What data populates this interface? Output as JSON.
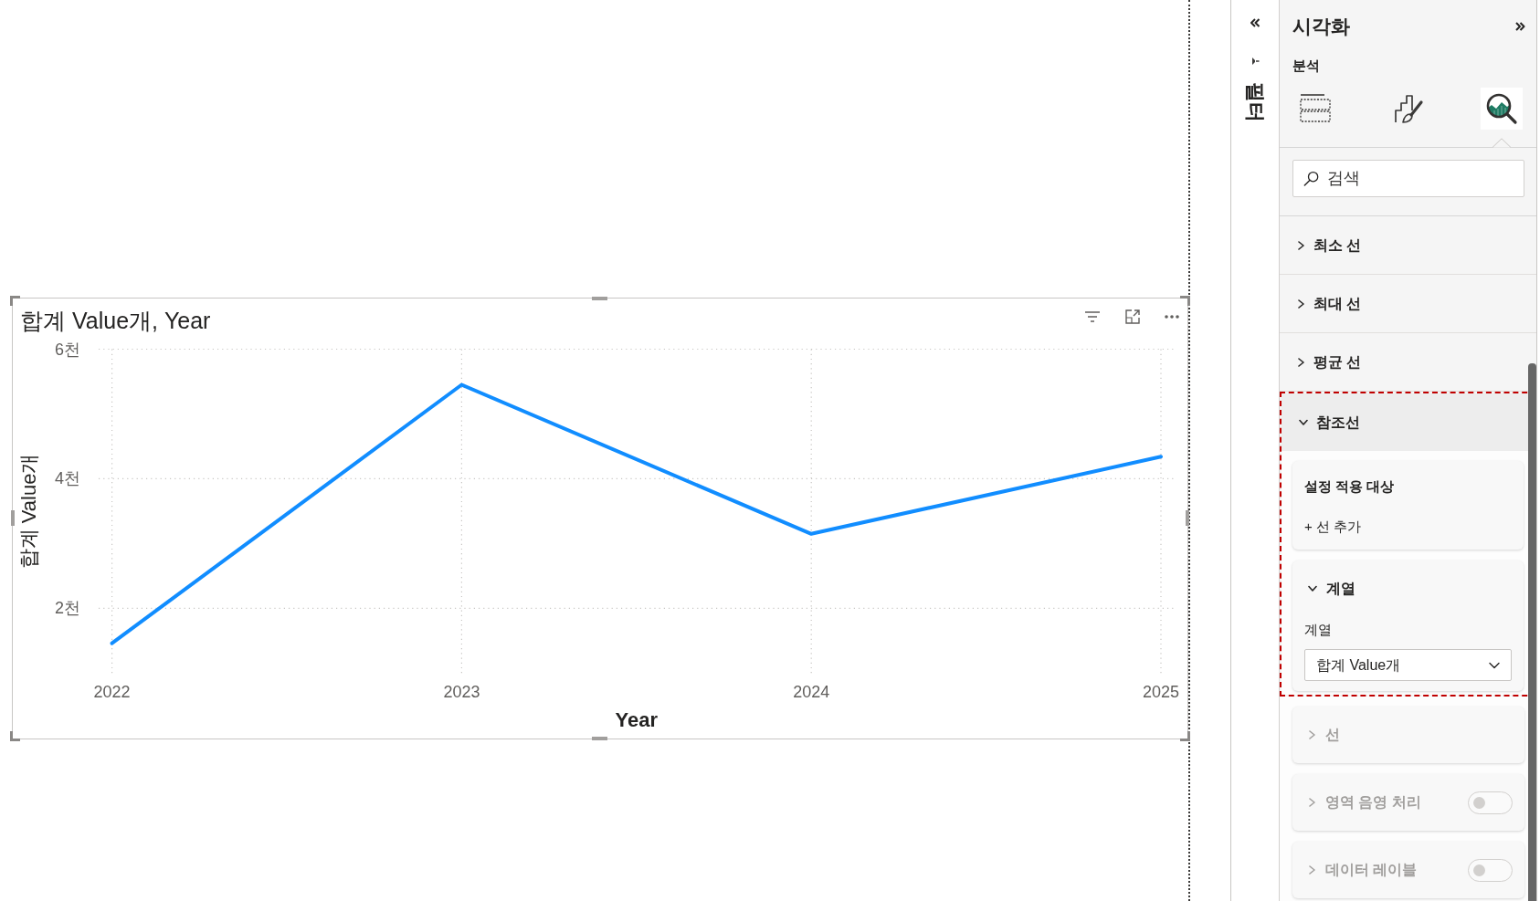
{
  "report_canvas": {
    "visual": {
      "selected": true,
      "chart_data": {
        "type": "line",
        "title": "합계 Value개, Year",
        "xlabel": "Year",
        "ylabel": "합계 Value개",
        "categories": [
          "2022",
          "2023",
          "2024",
          "2025"
        ],
        "series": [
          {
            "color": "#118dff",
            "values": [
              1.46,
              5.45,
              3.15,
              4.34
            ]
          }
        ],
        "ylim": [
          1,
          6
        ],
        "yticks": [
          {
            "value": 2,
            "label": "2천"
          },
          {
            "value": 4,
            "label": "4천"
          },
          {
            "value": 6,
            "label": "6천"
          }
        ],
        "grid": true
      }
    }
  },
  "filters_pane": {
    "title": "필터"
  },
  "visualizations_pane": {
    "title": "시각화",
    "subtitle": "분석",
    "tabs": [
      {
        "kind": "build",
        "selected": false
      },
      {
        "kind": "format",
        "selected": false
      },
      {
        "kind": "analytics",
        "selected": true
      }
    ],
    "search": {
      "placeholder": "검색"
    },
    "sections": [
      {
        "label": "최소 선",
        "expanded": false,
        "highlighted": false
      },
      {
        "label": "최대 선",
        "expanded": false,
        "highlighted": false
      },
      {
        "label": "평균 선",
        "expanded": false,
        "highlighted": false
      },
      {
        "label": "참조선",
        "expanded": true,
        "highlighted": true,
        "cards": [
          {
            "kind": "apply_to",
            "heading": "설정 적용 대상",
            "action": "+ 선 추가",
            "disabled": false,
            "highlighted": true
          },
          {
            "kind": "group",
            "label": "계열",
            "expanded": true,
            "disabled": false,
            "highlighted": true,
            "field": {
              "label": "계열",
              "value": "합계 Value개"
            }
          },
          {
            "kind": "group",
            "label": "선",
            "expanded": false,
            "disabled": true,
            "highlighted": false
          },
          {
            "kind": "toggle_group",
            "label": "영역 음영 처리",
            "expanded": false,
            "disabled": true,
            "highlighted": false,
            "on": false
          },
          {
            "kind": "toggle_group",
            "label": "데이터 레이블",
            "expanded": false,
            "disabled": true,
            "highlighted": false,
            "on": false
          }
        ]
      }
    ]
  }
}
